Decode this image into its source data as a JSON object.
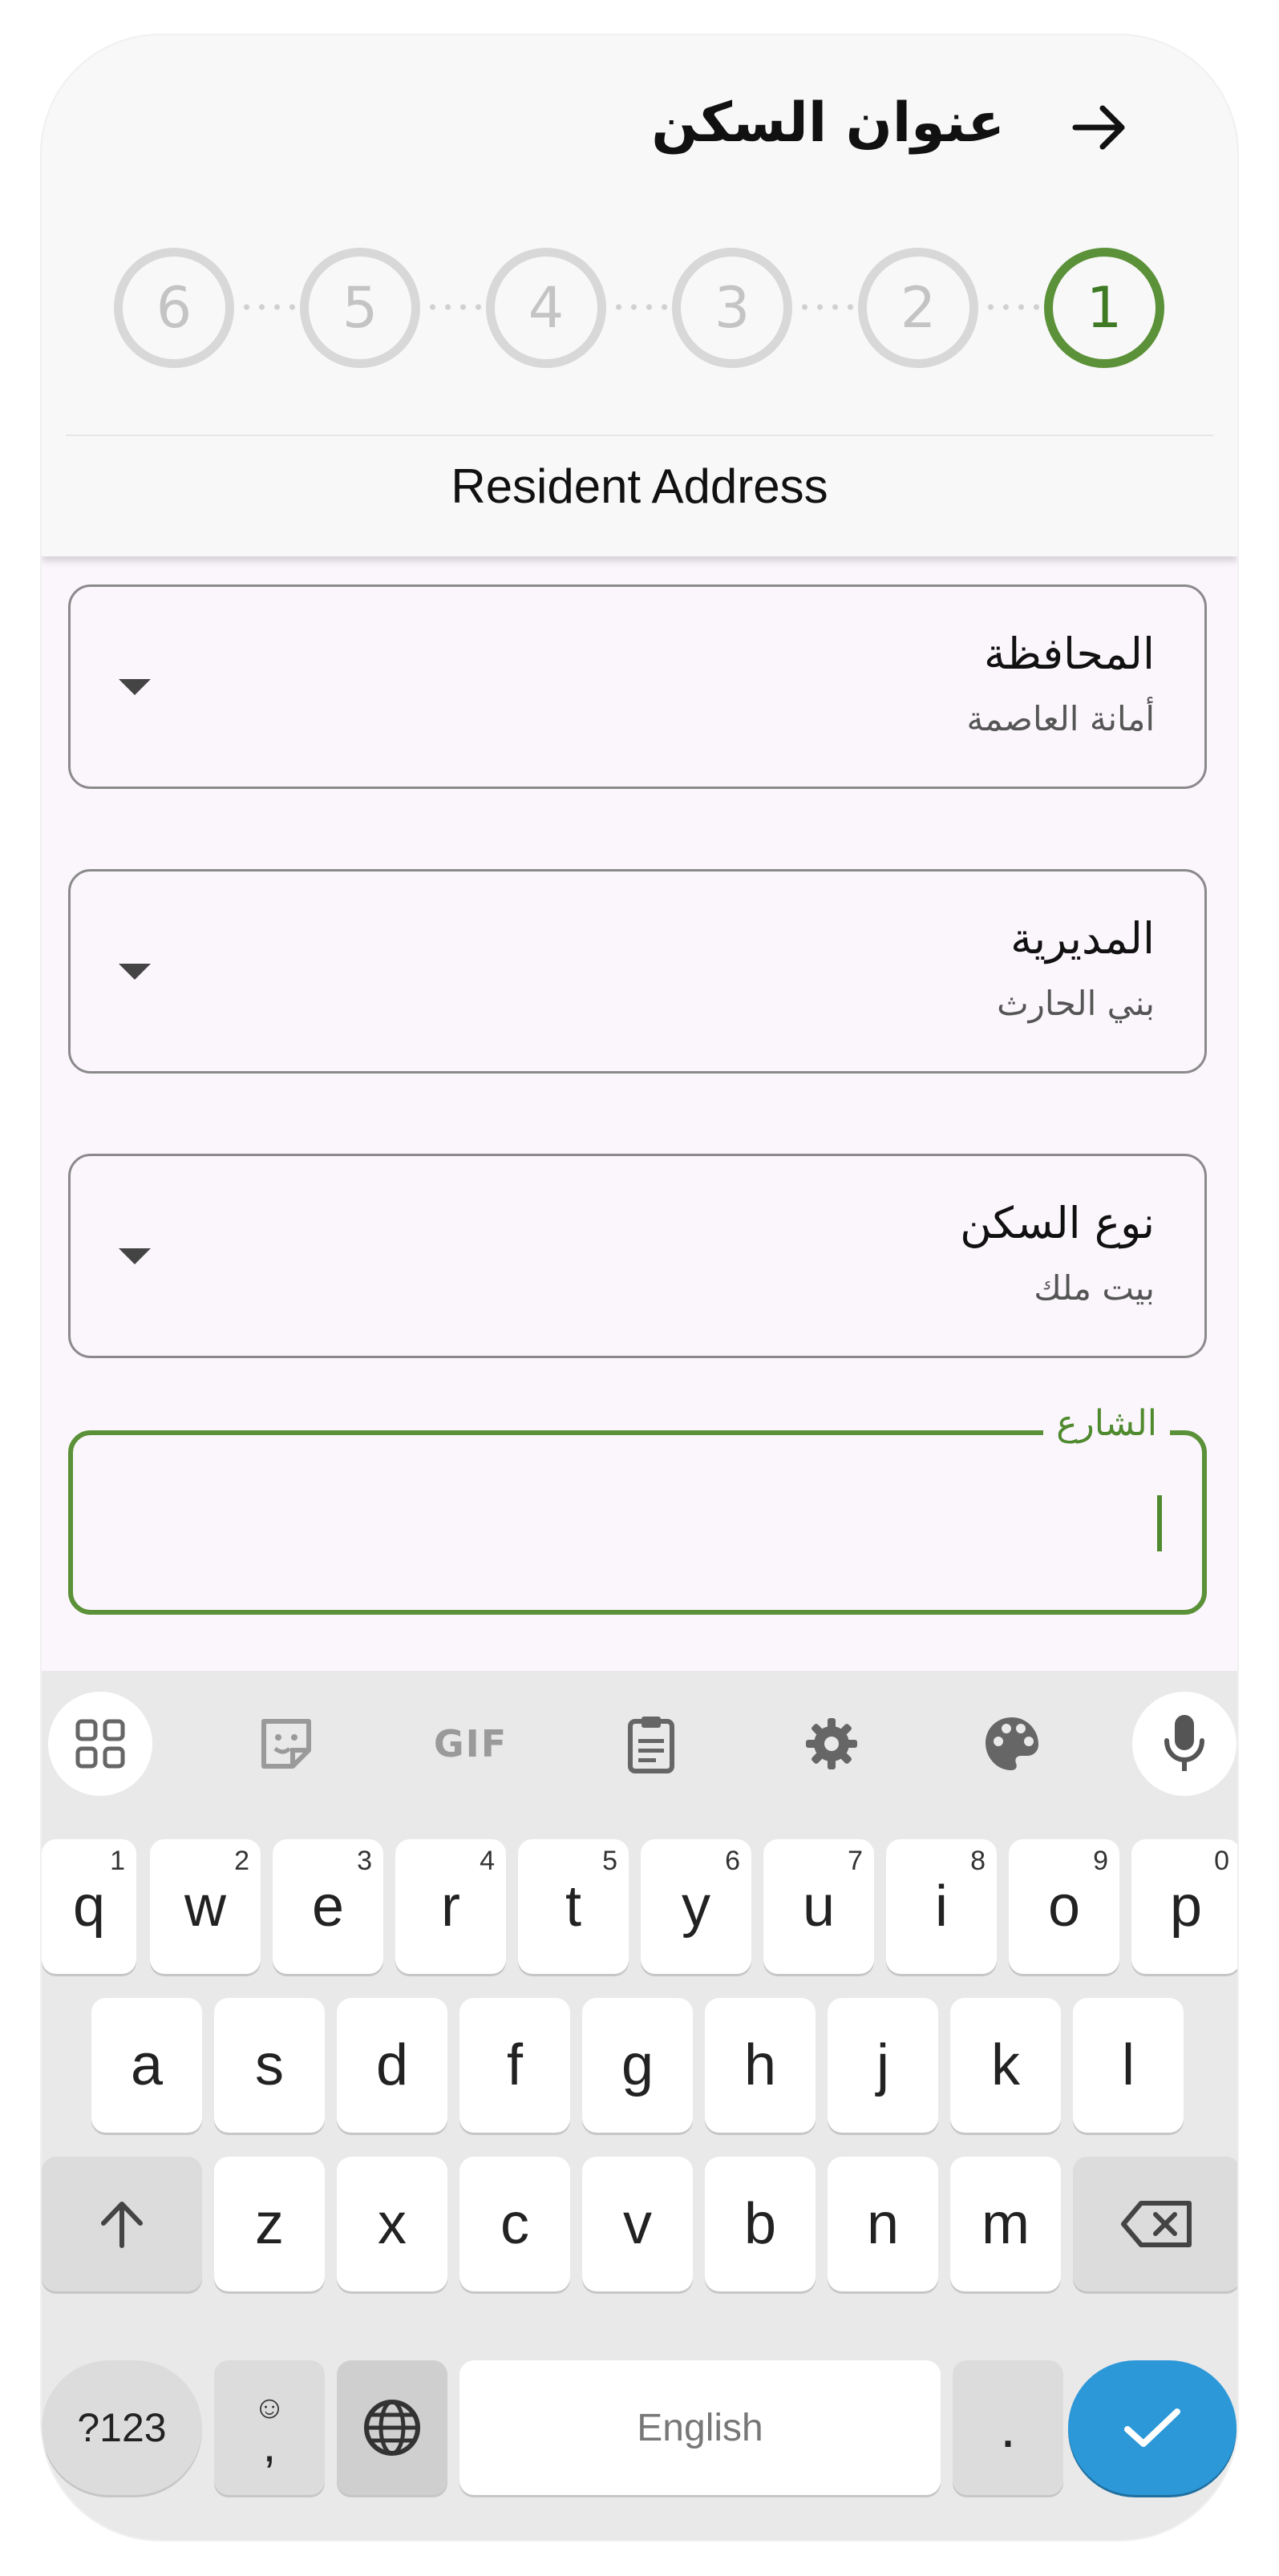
{
  "header": {
    "title": "عنوان السكن",
    "subtitle": "Resident Address",
    "steps": [
      "1",
      "2",
      "3",
      "4",
      "5",
      "6"
    ],
    "active_step": 1
  },
  "form": {
    "governorate": {
      "label": "المحافظة",
      "value": "أمانة العاصمة"
    },
    "district": {
      "label": "المديرية",
      "value": "بني الحارث"
    },
    "housing_type": {
      "label": "نوع السكن",
      "value": "بيت ملك"
    },
    "street": {
      "label": "الشارع",
      "value": ""
    }
  },
  "keyboard": {
    "toolbar": {
      "gif_label": "GIF"
    },
    "row1": [
      "q",
      "w",
      "e",
      "r",
      "t",
      "y",
      "u",
      "i",
      "o",
      "p"
    ],
    "row1_hints": [
      "1",
      "2",
      "3",
      "4",
      "5",
      "6",
      "7",
      "8",
      "9",
      "0"
    ],
    "row2": [
      "a",
      "s",
      "d",
      "f",
      "g",
      "h",
      "j",
      "k",
      "l"
    ],
    "row3": [
      "z",
      "x",
      "c",
      "v",
      "b",
      "n",
      "m"
    ],
    "symbols_label": "?123",
    "comma_label": ",",
    "emoji_hint": "☺",
    "space_label": "English",
    "period_label": "."
  },
  "colors": {
    "accent_green": "#5b9138",
    "enter_blue": "#2c98d8",
    "inactive_step": "#d8d8d8"
  }
}
